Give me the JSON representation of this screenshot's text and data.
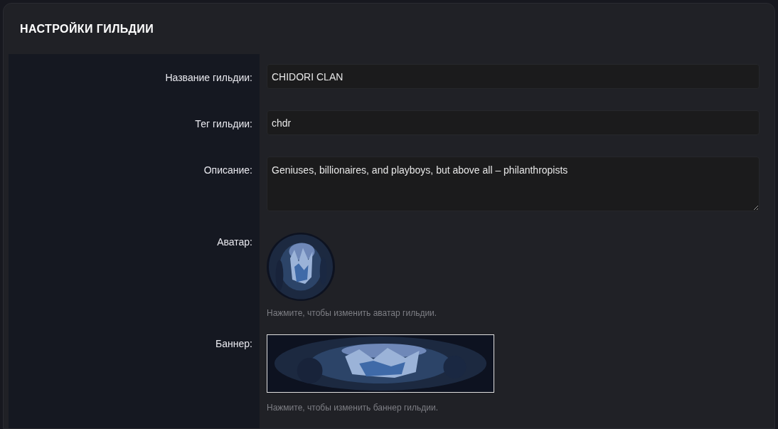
{
  "title": "НАСТРОЙКИ ГИЛЬДИИ",
  "fields": [
    {
      "kind": "text",
      "label": "Название гильдии:",
      "value": "CHIDORI CLAN"
    },
    {
      "kind": "text",
      "label": "Тег гильдии:",
      "value": "chdr"
    },
    {
      "kind": "textarea",
      "label": "Описание:",
      "value": "Geniuses, billionaires, and playboys, but above all – philanthropists"
    },
    {
      "kind": "avatar",
      "label": "Аватар:",
      "hint": "Нажмите, чтобы изменить аватар гильдии."
    },
    {
      "kind": "banner",
      "label": "Баннер:",
      "hint": "Нажмите, чтобы изменить баннер гильдии."
    }
  ]
}
